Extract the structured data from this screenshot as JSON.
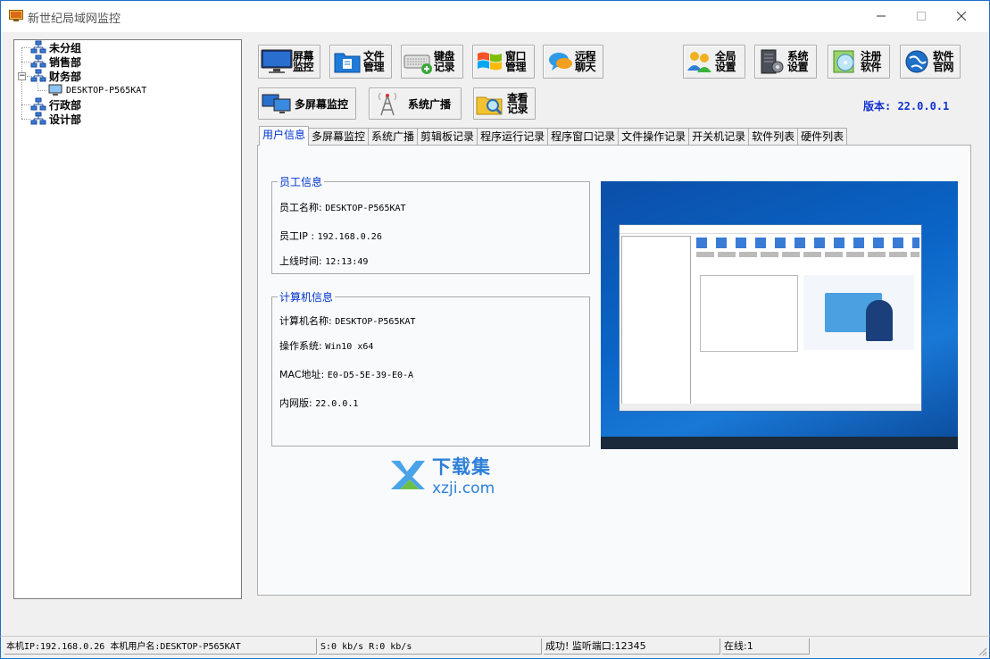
{
  "window": {
    "title": "新世纪局域网监控",
    "min_icon": "minimize-icon",
    "max_icon": "maximize-icon",
    "close_icon": "close-icon"
  },
  "tree": {
    "groups": [
      {
        "label": "未分组"
      },
      {
        "label": "销售部"
      },
      {
        "label": "财务部",
        "expanded": true,
        "children": [
          {
            "label": "DESKTOP-P565KAT"
          }
        ]
      },
      {
        "label": "行政部"
      },
      {
        "label": "设计部"
      }
    ]
  },
  "toolbar": {
    "screen_monitor": [
      "屏幕",
      "监控"
    ],
    "file_manage": [
      "文件",
      "管理"
    ],
    "keyboard_log": [
      "键盘",
      "记录"
    ],
    "window_manage": [
      "窗口",
      "管理"
    ],
    "remote_chat": [
      "远程",
      "聊天"
    ],
    "global_settings": [
      "全局",
      "设置"
    ],
    "system_settings": [
      "系统",
      "设置"
    ],
    "register": [
      "注册",
      "软件"
    ],
    "website": [
      "软件",
      "官网"
    ],
    "multi_screen": "多屏幕监控",
    "broadcast": "系统广播",
    "view_records": [
      "查看",
      "记录"
    ]
  },
  "version": "版本: 22.0.0.1",
  "tabs": [
    {
      "label": "用户信息",
      "active": true
    },
    {
      "label": "多屏幕监控"
    },
    {
      "label": "系统广播"
    },
    {
      "label": "剪辑板记录"
    },
    {
      "label": "程序运行记录"
    },
    {
      "label": "程序窗口记录"
    },
    {
      "label": "文件操作记录"
    },
    {
      "label": "开关机记录"
    },
    {
      "label": "软件列表"
    },
    {
      "label": "硬件列表"
    }
  ],
  "employee": {
    "title": "员工信息",
    "name_label": "员工名称:",
    "name_value": "DESKTOP-P565KAT",
    "ip_label": "员工IP :",
    "ip_value": "192.168.0.26",
    "online_label": "上线时间:",
    "online_value": "12:13:49"
  },
  "computer": {
    "title": "计算机信息",
    "name_label": "计算机名称:",
    "name_value": "DESKTOP-P565KAT",
    "os_label": "操作系统:",
    "os_value": "Win10 x64",
    "mac_label": "MAC地址:",
    "mac_value": "E0-D5-5E-39-E0-A",
    "intranet_label": "内网版:",
    "intranet_value": "22.0.0.1"
  },
  "watermark": {
    "text": "下载集",
    "domain": "xzji.com"
  },
  "statusbar": {
    "local": "本机IP:192.168.0.26  本机用户名:DESKTOP-P565KAT",
    "speed": "S:0 kb/s R:0 kb/s",
    "listen": "成功! 监听端口:12345",
    "online": "在线:1"
  },
  "colors": {
    "accent_blue": "#0033cc",
    "version_blue": "#1030d0",
    "window_border": "#1e6fc8",
    "watermark_blue": "#2c7fd8"
  }
}
